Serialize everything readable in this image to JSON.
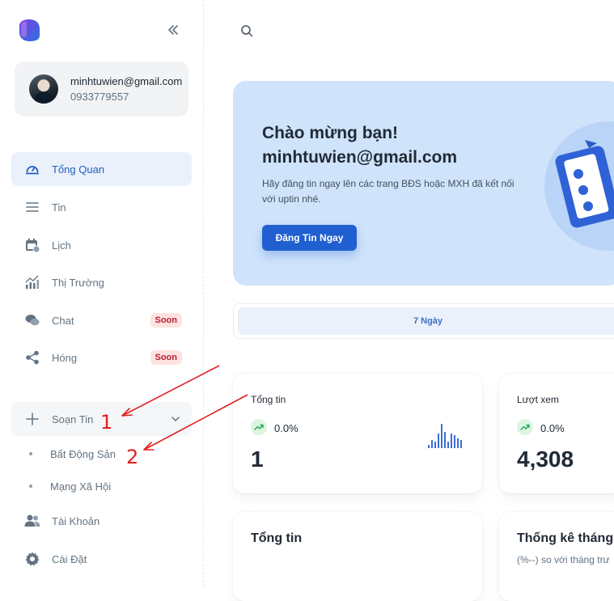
{
  "user": {
    "email": "minhtuwien@gmail.com",
    "phone": "0933779557"
  },
  "nav": {
    "overview": "Tổng Quan",
    "posts": "Tin",
    "calendar": "Lịch",
    "market": "Thị Trường",
    "chat": "Chat",
    "share": "Hóng",
    "compose": "Soạn Tin",
    "compose_real_estate": "Bất Động Sản",
    "compose_social": "Mạng Xã Hội",
    "account": "Tài Khoản",
    "settings": "Cài Đặt",
    "soon_badge": "Soon"
  },
  "annotations": {
    "mark_1": "1",
    "mark_2": "2"
  },
  "banner": {
    "title": "Chào mừng bạn!",
    "email": "minhtuwien@gmail.com",
    "description": "Hãy đăng tin ngay lên các trang BĐS hoặc MXH đã kết nối với uptin nhé.",
    "button": "Đăng Tin Ngay"
  },
  "filter": {
    "selected": "7 Ngày"
  },
  "stats": [
    {
      "label": "Tổng tin",
      "change": "0.0%",
      "value": "1"
    },
    {
      "label": "Lượt xem",
      "change": "0.0%",
      "value": "4,308"
    }
  ],
  "sections": {
    "total_posts_title": "Tổng tin",
    "monthly_title": "Thống kê tháng",
    "monthly_subtitle": "(%--) so với tháng trư"
  },
  "colors": {
    "accent": "#1f5fd0",
    "active_bg": "#eaf1fb",
    "banner_bg": "#cfe3fb",
    "soon_bg": "#fde3df",
    "annotation": "#e02020"
  },
  "icons": [
    "logo-icon",
    "collapse-icon",
    "dashboard-icon",
    "list-icon",
    "calendar-icon",
    "chart-icon",
    "chat-icon",
    "share-icon",
    "plus-icon",
    "chevron-down-icon",
    "users-icon",
    "gear-icon",
    "search-icon",
    "trend-up-icon"
  ]
}
